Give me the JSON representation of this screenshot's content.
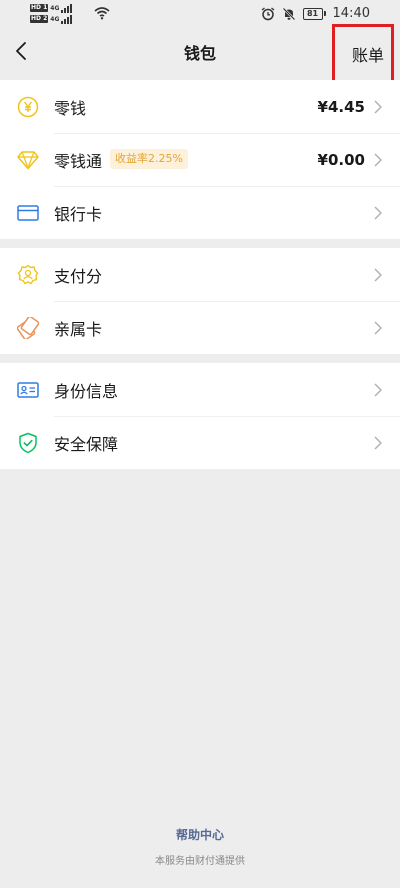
{
  "status_bar": {
    "sim1_tag": "HD 1",
    "sim2_tag": "HD 2",
    "net1": "4G",
    "net2": "4G",
    "battery": "81",
    "time": "14:40"
  },
  "header": {
    "title": "钱包",
    "bill_label": "账单"
  },
  "groups": [
    [
      {
        "icon": "yuan-coin-icon",
        "label": "零钱",
        "value": "¥4.45"
      },
      {
        "icon": "diamond-icon",
        "label": "零钱通",
        "badge": "收益率2.25%",
        "value": "¥0.00"
      },
      {
        "icon": "bank-card-icon",
        "label": "银行卡"
      }
    ],
    [
      {
        "icon": "payment-score-icon",
        "label": "支付分"
      },
      {
        "icon": "family-card-icon",
        "label": "亲属卡"
      }
    ],
    [
      {
        "icon": "identity-card-icon",
        "label": "身份信息"
      },
      {
        "icon": "security-shield-icon",
        "label": "安全保障"
      }
    ]
  ],
  "footer": {
    "help_center": "帮助中心",
    "provider_note": "本服务由财付通提供"
  },
  "colors": {
    "background": "#ededed",
    "highlight_box": "#e02020",
    "accent_yellow": "#f0c419",
    "accent_green": "#07c160",
    "accent_blue": "#2f7be5",
    "link_blue": "#576b95",
    "badge_text": "#e3a637"
  }
}
